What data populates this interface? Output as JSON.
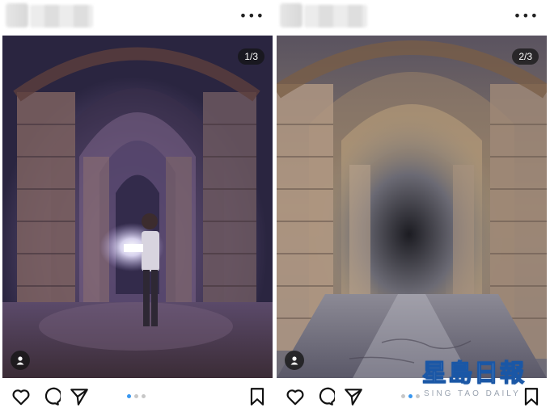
{
  "posts": [
    {
      "id_name": "left",
      "menu_glyph": "•••",
      "counter": "1/3",
      "icons": [
        "like-heart-icon",
        "comment-bubble-icon",
        "share-send-icon",
        "bookmark-icon",
        "user-tag-icon"
      ],
      "carousel": {
        "total": 3,
        "active": 1
      }
    },
    {
      "id_name": "right",
      "menu_glyph": "•••",
      "counter": "2/3",
      "icons": [
        "like-heart-icon",
        "comment-bubble-icon",
        "share-send-icon",
        "bookmark-icon",
        "user-tag-icon"
      ],
      "carousel": {
        "total": 3,
        "active": 2
      }
    }
  ],
  "watermark": {
    "title": "星島日報",
    "subtitle": "SING TAO DAILY",
    "color": "#1a57a6"
  }
}
